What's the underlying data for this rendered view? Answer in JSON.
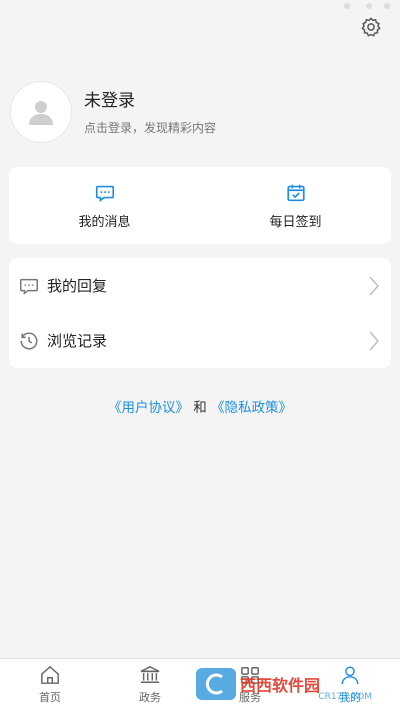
{
  "profile": {
    "title": "未登录",
    "subtitle": "点击登录，发现精彩内容"
  },
  "quick_actions": [
    {
      "label": "我的消息",
      "icon": "message-icon"
    },
    {
      "label": "每日签到",
      "icon": "calendar-check-icon"
    }
  ],
  "menu": [
    {
      "label": "我的回复",
      "icon": "comment-icon"
    },
    {
      "label": "浏览记录",
      "icon": "history-icon"
    }
  ],
  "agreement": {
    "user_agreement": "《用户协议》",
    "conjunction": "和",
    "privacy_policy": "《隐私政策》"
  },
  "tabs": [
    {
      "label": "首页",
      "icon": "home-icon"
    },
    {
      "label": "政务",
      "icon": "government-icon"
    },
    {
      "label": "服务",
      "icon": "service-icon"
    },
    {
      "label": "我的",
      "icon": "profile-icon",
      "active": true
    }
  ],
  "watermark": {
    "text": "西西软件园",
    "url": "CR173.COM"
  },
  "colors": {
    "accent": "#1e8fe0",
    "background": "#f4f4f4",
    "card": "#ffffff"
  }
}
